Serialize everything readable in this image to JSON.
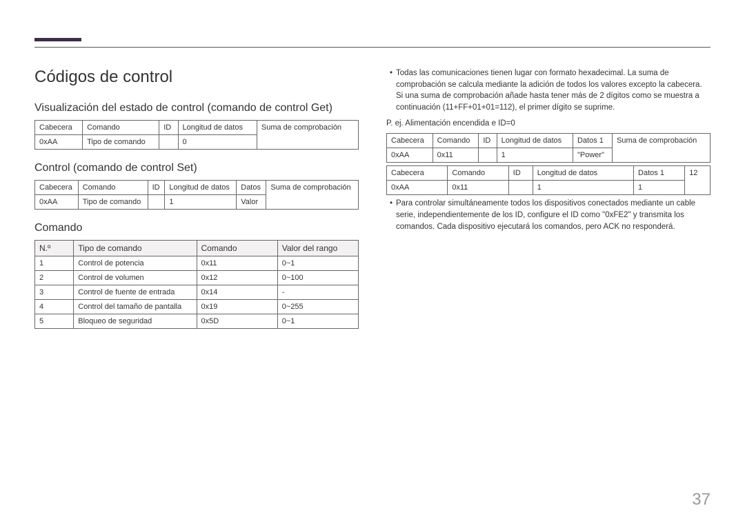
{
  "pageNumber": "37",
  "title": "Códigos de control",
  "left": {
    "section1": {
      "heading": "Visualización del estado de control (comando de control Get)",
      "table": {
        "rows": [
          [
            "Cabecera",
            "Comando",
            "ID",
            "Longitud de datos",
            "Suma de comprobación"
          ],
          [
            "0xAA",
            "Tipo de comando",
            "",
            "0",
            ""
          ]
        ]
      }
    },
    "section2": {
      "heading": "Control (comando de control Set)",
      "table": {
        "rows": [
          [
            "Cabecera",
            "Comando",
            "ID",
            "Longitud de datos",
            "Datos",
            "Suma de comprobación"
          ],
          [
            "0xAA",
            "Tipo de comando",
            "",
            "1",
            "Valor",
            ""
          ]
        ]
      }
    },
    "section3": {
      "heading": "Comando",
      "table": {
        "header": [
          "N.º",
          "Tipo de comando",
          "Comando",
          "Valor del rango"
        ],
        "rows": [
          [
            "1",
            "Control de potencia",
            "0x11",
            "0~1"
          ],
          [
            "2",
            "Control de volumen",
            "0x12",
            "0~100"
          ],
          [
            "3",
            "Control de fuente de entrada",
            "0x14",
            "-"
          ],
          [
            "4",
            "Control del tamaño de pantalla",
            "0x19",
            "0~255"
          ],
          [
            "5",
            "Bloqueo de seguridad",
            "0x5D",
            "0~1"
          ]
        ]
      }
    }
  },
  "right": {
    "bullet1": "Todas las comunicaciones tienen lugar con formato hexadecimal. La suma de comprobación se calcula mediante la adición de todos los valores excepto la cabecera. Si una suma de comprobación añade hasta tener más de 2 dígitos como se muestra a continuación (11+FF+01+01=112), el primer dígito se suprime.",
    "example": "P. ej. Alimentación encendida e ID=0",
    "table1": {
      "rows": [
        [
          "Cabecera",
          "Comando",
          "ID",
          "Longitud de datos",
          "Datos 1",
          "Suma de comprobación"
        ],
        [
          "0xAA",
          "0x11",
          "",
          "1",
          "\"Power\"",
          ""
        ]
      ]
    },
    "table2": {
      "rows": [
        [
          "Cabecera",
          "Comando",
          "ID",
          "Longitud de datos",
          "Datos 1",
          "12"
        ],
        [
          "0xAA",
          "0x11",
          "",
          "1",
          "1",
          ""
        ]
      ]
    },
    "bullet2": "Para controlar simultáneamente todos los dispositivos conectados mediante un cable serie, independientemente de los ID, configure el ID como \"0xFE2\" y transmita los comandos. Cada dispositivo ejecutará los comandos, pero ACK no responderá."
  }
}
